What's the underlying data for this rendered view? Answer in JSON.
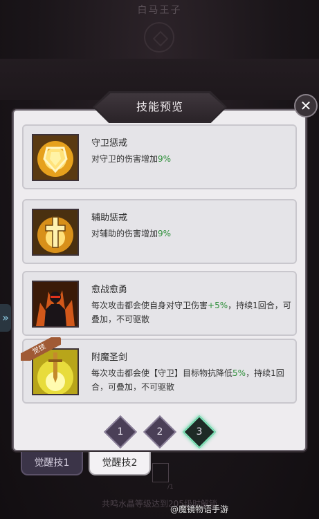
{
  "background": {
    "character_name": "白马王子",
    "unlock_note": "共鸣水晶等级达到205级时解锁",
    "level_hint": "/1"
  },
  "dialog": {
    "title": "技能预览",
    "close_label": "✕"
  },
  "skills": [
    {
      "name": "守卫惩戒",
      "desc_prefix": "对守卫的伤害增加",
      "desc_value": "9%",
      "desc_suffix": "",
      "icon": "shield-skill-icon"
    },
    {
      "name": "辅助惩戒",
      "desc_prefix": "对辅助的伤害增加",
      "desc_value": "9%",
      "desc_suffix": "",
      "icon": "cross-skill-icon"
    },
    {
      "name": "愈战愈勇",
      "desc_prefix": "每次攻击都会使自身对守卫伤害",
      "desc_value": "+5%",
      "desc_suffix": "，持续1回合，可叠加，不可驱散",
      "icon": "warrior-skill-icon"
    },
    {
      "name": "附魔圣剑",
      "desc_prefix": "每次攻击都会使【守卫】目标物抗降低",
      "desc_value": "5%",
      "desc_suffix": "，持续1回合，可叠加，不可驱散",
      "icon": "holy-sword-skill-icon",
      "badge": "觉技"
    }
  ],
  "pagination": {
    "pages": [
      "1",
      "2",
      "3"
    ],
    "active": 3
  },
  "tabs": [
    {
      "label": "觉醒技1"
    },
    {
      "label": "觉醒技2"
    }
  ],
  "watermark": "@魔镜物语手游",
  "colors": {
    "accent_green": "#2e8f3a",
    "active_page": "#7de4b8"
  }
}
